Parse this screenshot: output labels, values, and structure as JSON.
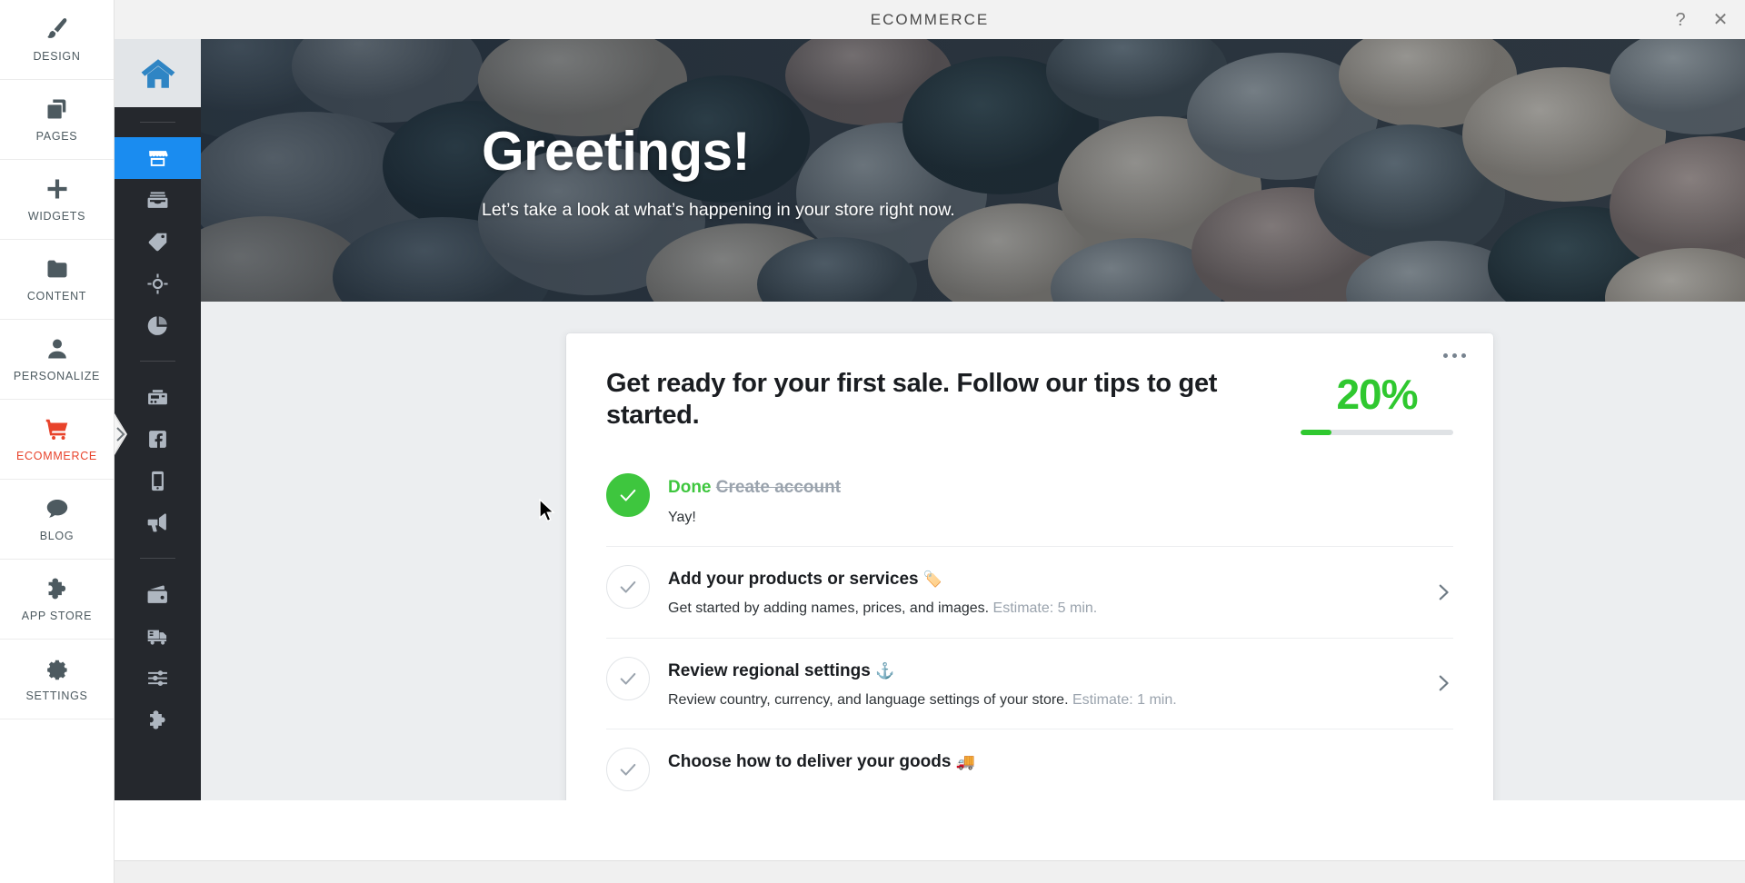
{
  "topbar": {
    "title": "ECOMMERCE",
    "help_label": "?",
    "close_label": "✕"
  },
  "mainnav": {
    "items": [
      {
        "label": "DESIGN",
        "icon": "brush-icon",
        "active": false
      },
      {
        "label": "PAGES",
        "icon": "pages-icon",
        "active": false
      },
      {
        "label": "WIDGETS",
        "icon": "plus-icon",
        "active": false
      },
      {
        "label": "CONTENT",
        "icon": "folder-icon",
        "active": false
      },
      {
        "label": "PERSONALIZE",
        "icon": "person-icon",
        "active": false
      },
      {
        "label": "ECOMMERCE",
        "icon": "shopping-cart-icon",
        "active": true
      },
      {
        "label": "BLOG",
        "icon": "chat-bubble-icon",
        "active": false
      },
      {
        "label": "APP STORE",
        "icon": "puzzle-piece-icon",
        "active": false
      },
      {
        "label": "SETTINGS",
        "icon": "gear-icon",
        "active": false
      }
    ]
  },
  "subnav": {
    "home_icon": "home-icon",
    "groups": [
      [
        {
          "icon": "storefront-icon",
          "active": true
        },
        {
          "icon": "inbox-orders-icon",
          "active": false
        },
        {
          "icon": "price-tag-icon",
          "active": false
        },
        {
          "icon": "target-icon",
          "active": false
        },
        {
          "icon": "pie-chart-icon",
          "active": false
        }
      ],
      [
        {
          "icon": "cash-register-icon",
          "active": false
        },
        {
          "icon": "facebook-icon",
          "active": false
        },
        {
          "icon": "mobile-phone-icon",
          "active": false
        },
        {
          "icon": "megaphone-icon",
          "active": false
        }
      ],
      [
        {
          "icon": "wallet-icon",
          "active": false
        },
        {
          "icon": "delivery-truck-icon",
          "active": false
        },
        {
          "icon": "sliders-icon",
          "active": false
        },
        {
          "icon": "puzzle-piece-icon",
          "active": false
        }
      ]
    ]
  },
  "hero": {
    "title": "Greetings!",
    "subtitle": "Let’s take a look at what’s happening in your store right now."
  },
  "card": {
    "title": "Get ready for your first sale. Follow our tips to get started.",
    "progress_percent_label": "20%",
    "progress_value": 20,
    "progress_color": "#2fc82f",
    "menu_icon": "more-options-icon",
    "items": [
      {
        "done": true,
        "status_label": "Done",
        "title": "Create account",
        "emoji": "",
        "desc": "Yay!",
        "estimate": "",
        "chevron": false
      },
      {
        "done": false,
        "status_label": "",
        "title": "Add your products or services",
        "emoji": "🏷️",
        "desc": "Get started by adding names, prices, and images.",
        "estimate": "Estimate: 5 min.",
        "chevron": true
      },
      {
        "done": false,
        "status_label": "",
        "title": "Review regional settings",
        "emoji": "⚓",
        "desc": "Review country, currency, and language settings of your store.",
        "estimate": "Estimate: 1 min.",
        "chevron": true
      },
      {
        "done": false,
        "status_label": "",
        "title": "Choose how to deliver your goods",
        "emoji": "🚚",
        "desc": "",
        "estimate": "",
        "chevron": false
      }
    ]
  },
  "colors": {
    "accent_red": "#e8432b",
    "accent_blue": "#1a8cf0",
    "sidebar_dark": "#25282d",
    "success_green": "#3ec63e"
  }
}
